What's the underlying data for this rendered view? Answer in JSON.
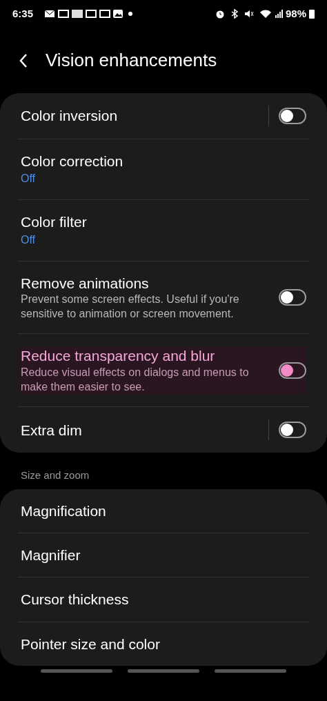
{
  "status_bar": {
    "time": "6:35",
    "battery": "98%"
  },
  "header": {
    "title": "Vision enhancements"
  },
  "groups": [
    {
      "items": [
        {
          "title": "Color inversion",
          "kind": "switch",
          "on": false,
          "divider": true,
          "highlighted": false
        },
        {
          "title": "Color correction",
          "subtitle": "Off",
          "kind": "link",
          "highlighted": false
        },
        {
          "title": "Color filter",
          "subtitle": "Off",
          "kind": "link",
          "highlighted": false
        },
        {
          "title": "Remove animations",
          "description": "Prevent some screen effects. Useful if you're sensitive to animation or screen movement.",
          "kind": "switch",
          "on": false,
          "divider": false,
          "highlighted": false
        },
        {
          "title": "Reduce transparency and blur",
          "description": "Reduce visual effects on dialogs and menus to make them easier to see.",
          "kind": "switch",
          "on": false,
          "divider": false,
          "highlighted": true
        },
        {
          "title": "Extra dim",
          "kind": "switch",
          "on": false,
          "divider": true,
          "highlighted": false
        }
      ]
    },
    {
      "heading": "Size and zoom",
      "items": [
        {
          "title": "Magnification",
          "kind": "link",
          "highlighted": false
        },
        {
          "title": "Magnifier",
          "kind": "link",
          "highlighted": false
        },
        {
          "title": "Cursor thickness",
          "kind": "link",
          "highlighted": false
        },
        {
          "title": "Pointer size and color",
          "kind": "link",
          "highlighted": false
        }
      ]
    }
  ]
}
